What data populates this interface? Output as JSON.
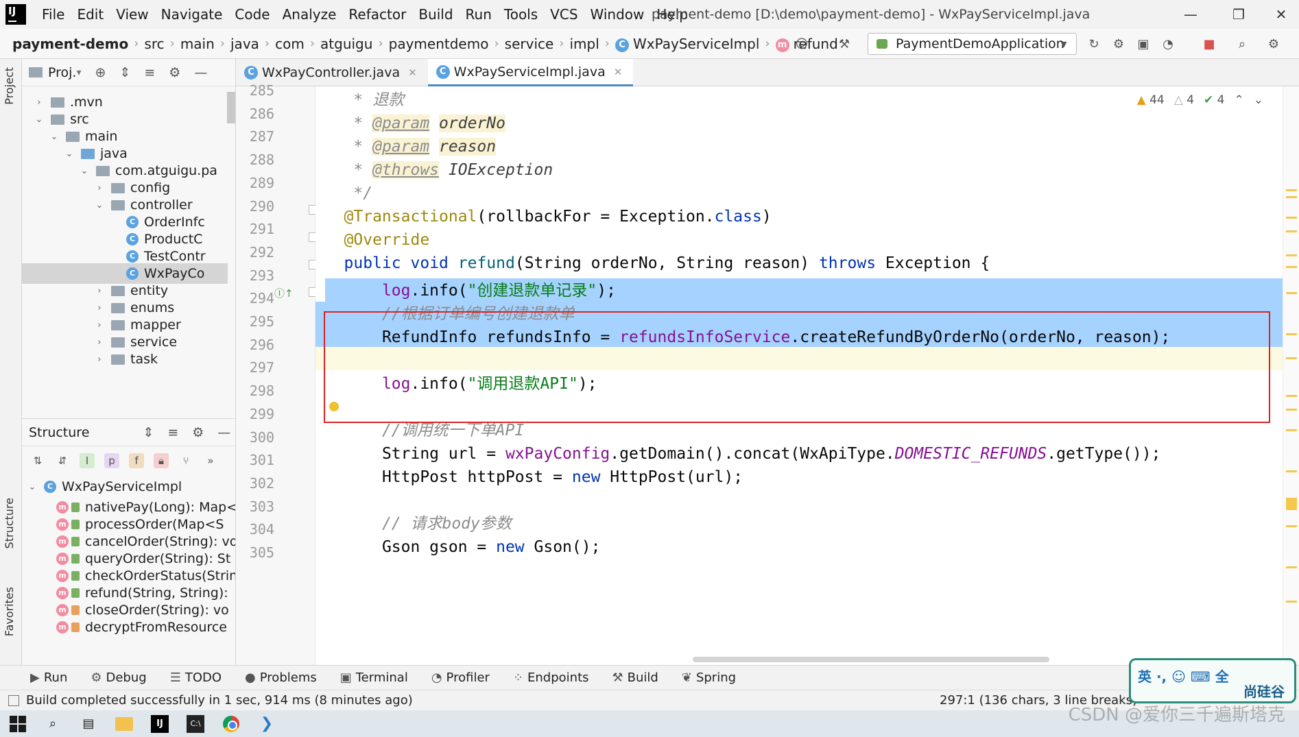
{
  "menubar": {
    "items": [
      "File",
      "Edit",
      "View",
      "Navigate",
      "Code",
      "Analyze",
      "Refactor",
      "Build",
      "Run",
      "Tools",
      "VCS",
      "Window",
      "Help"
    ],
    "window_title": "payment-demo [D:\\demo\\payment-demo] - WxPayServiceImpl.java",
    "logo": "IJ"
  },
  "navbar": {
    "crumbs": [
      "payment-demo",
      "src",
      "main",
      "java",
      "com",
      "atguigu",
      "paymentdemo",
      "service",
      "impl",
      "WxPayServiceImpl",
      "refund"
    ],
    "run_config": "PaymentDemoApplication"
  },
  "side_stripe": {
    "project": "Project",
    "structure": "Structure",
    "favorites": "Favorites"
  },
  "project_panel": {
    "title": "Proj.",
    "items": [
      {
        "label": ".mvn",
        "depth": 1,
        "expanded": false,
        "kind": "folder"
      },
      {
        "label": "src",
        "depth": 1,
        "expanded": true,
        "kind": "folder"
      },
      {
        "label": "main",
        "depth": 2,
        "expanded": true,
        "kind": "folder"
      },
      {
        "label": "java",
        "depth": 3,
        "expanded": true,
        "kind": "folder-blue"
      },
      {
        "label": "com.atguigu.pa",
        "depth": 4,
        "expanded": true,
        "kind": "folder"
      },
      {
        "label": "config",
        "depth": 5,
        "expanded": false,
        "kind": "folder"
      },
      {
        "label": "controller",
        "depth": 5,
        "expanded": true,
        "kind": "folder"
      },
      {
        "label": "OrderInfc",
        "depth": 6,
        "kind": "class"
      },
      {
        "label": "ProductC",
        "depth": 6,
        "kind": "class"
      },
      {
        "label": "TestContr",
        "depth": 6,
        "kind": "class"
      },
      {
        "label": "WxPayCo",
        "depth": 6,
        "kind": "class",
        "selected": true
      },
      {
        "label": "entity",
        "depth": 5,
        "expanded": false,
        "kind": "folder"
      },
      {
        "label": "enums",
        "depth": 5,
        "expanded": false,
        "kind": "folder"
      },
      {
        "label": "mapper",
        "depth": 5,
        "expanded": false,
        "kind": "folder"
      },
      {
        "label": "service",
        "depth": 5,
        "expanded": false,
        "kind": "folder"
      },
      {
        "label": "task",
        "depth": 5,
        "expanded": false,
        "kind": "folder"
      }
    ]
  },
  "structure_panel": {
    "title": "Structure",
    "root": "WxPayServiceImpl",
    "items": [
      {
        "label": "nativePay(Long): Map<",
        "access": "pub"
      },
      {
        "label": "processOrder(Map<S",
        "access": "pub"
      },
      {
        "label": "cancelOrder(String): vo",
        "access": "pub"
      },
      {
        "label": "queryOrder(String): St",
        "access": "pub"
      },
      {
        "label": "checkOrderStatus(Strin",
        "access": "pub"
      },
      {
        "label": "refund(String, String): ",
        "access": "pub"
      },
      {
        "label": "closeOrder(String): vo",
        "access": "priv"
      },
      {
        "label": "decryptFromResource",
        "access": "priv"
      }
    ]
  },
  "editor": {
    "tabs": [
      {
        "label": "WxPayController.java",
        "active": false
      },
      {
        "label": "WxPayServiceImpl.java",
        "active": true
      }
    ],
    "inspections": {
      "warnings": "44",
      "weak_warnings": "4",
      "typos": "4"
    },
    "line_numbers": [
      "285",
      "286",
      "287",
      "288",
      "289",
      "290",
      "291",
      "292",
      "293",
      "294",
      "295",
      "296",
      "297",
      "298",
      "299",
      "300",
      "301",
      "302",
      "303",
      "304",
      "305"
    ],
    "code": {
      "l285_star": "* ",
      "l285_text": "退款",
      "l286_star": "* ",
      "l286_tag": "@param",
      "l286_name": "orderNo",
      "l287_star": "* ",
      "l287_tag": "@param",
      "l287_name": "reason",
      "l288_star": "* ",
      "l288_tag": "@throws",
      "l288_name": "IOException",
      "l289": "*/",
      "l290_ann": "@Transactional",
      "l290_rest1": "(rollbackFor = Exception.",
      "l290_kw": "class",
      "l290_rest2": ")",
      "l291_ann": "@Override",
      "l292_kw1": "public",
      "l292_kw2": "void",
      "l292_fn": "refund",
      "l292_rest1": "(String orderNo, String reason) ",
      "l292_kw3": "throws",
      "l292_rest2": " Exception {",
      "l294_field": "log",
      "l294_mid": ".info(",
      "l294_str": "\"创建退款单记录\"",
      "l294_end": ");",
      "l295_cmt": "//根据订单编号创建退款单",
      "l296_pre": "RefundInfo refundsInfo = ",
      "l296_field": "refundsInfoService",
      "l296_rest": ".createRefundByOrderNo(orderNo, reason);",
      "l298_field": "log",
      "l298_mid": ".info(",
      "l298_str": "\"调用退款API\"",
      "l298_end": ");",
      "l300_cmt": "//调用统一下单API",
      "l301_pre": "String url = ",
      "l301_field": "wxPayConfig",
      "l301_mid": ".getDomain().concat(WxApiType.",
      "l301_const": "DOMESTIC_REFUNDS",
      "l301_end": ".getType());",
      "l302_pre": "HttpPost httpPost = ",
      "l302_kw": "new",
      "l302_end": " HttpPost(url);",
      "l304_cmt": "// 请求body参数",
      "l305_pre": "Gson gson = ",
      "l305_kw": "new",
      "l305_end": " Gson();"
    }
  },
  "bottom_tools": [
    "Run",
    "Debug",
    "TODO",
    "Problems",
    "Terminal",
    "Profiler",
    "Endpoints",
    "Build",
    "Spring"
  ],
  "status": {
    "message": "Build completed successfully in 1 sec, 914 ms (8 minutes ago)",
    "position": "297:1 (136 chars, 3 line breaks)"
  },
  "overlay": {
    "ime": "英 ·, ☺  ⌨ 全",
    "brand": "尚硅谷",
    "watermark": "CSDN @爱你三千遍斯塔克"
  },
  "colors": {
    "keyword": "#0033b3",
    "annotation": "#9e880d",
    "string": "#067d17",
    "field": "#871094",
    "selection": "#a6d2ff",
    "highlight_box": "#e02020"
  }
}
